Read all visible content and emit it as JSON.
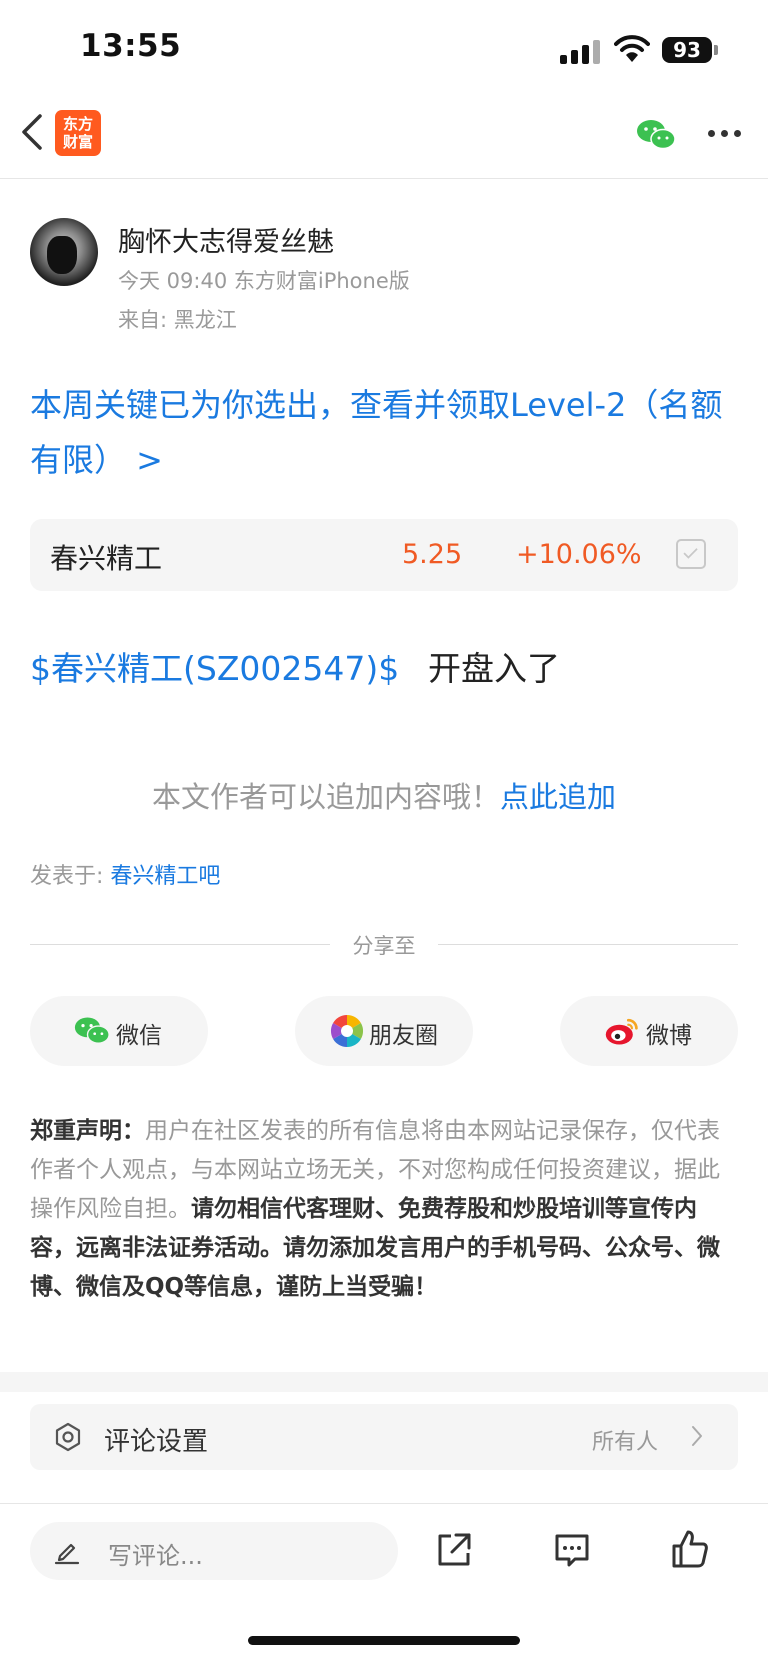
{
  "status_bar": {
    "time": "13:55",
    "battery": "93"
  },
  "nav": {
    "logo_line1": "东方",
    "logo_line2": "财富"
  },
  "author": {
    "name": "胸怀大志得爱丝魅",
    "meta": "今天 09:40 东方财富iPhone版",
    "from": "来自: 黑龙江"
  },
  "promo": {
    "text": "本周关键已为你选出，查看并领取Level-2（名额有限） >"
  },
  "stock": {
    "name": "春兴精工",
    "price": "5.25",
    "change": "+10.06%",
    "color": "#f05a24"
  },
  "post": {
    "tag": "$春兴精工(SZ002547)$",
    "text": "开盘入了"
  },
  "append": {
    "prompt": "本文作者可以追加内容哦！",
    "link": "点此追加"
  },
  "published": {
    "label": "发表于: ",
    "forum": "春兴精工吧"
  },
  "share": {
    "title": "分享至",
    "buttons": [
      {
        "label": "微信",
        "icon": "wechat-icon"
      },
      {
        "label": "朋友圈",
        "icon": "moments-icon"
      },
      {
        "label": "微博",
        "icon": "weibo-icon"
      }
    ]
  },
  "disclaimer": {
    "title": "郑重声明：",
    "normal": "用户在社区发表的所有信息将由本网站记录保存，仅代表作者个人观点，与本网站立场无关，不对您构成任何投资建议，据此操作风险自担。",
    "bold": "请勿相信代客理财、免费荐股和炒股培训等宣传内容，远离非法证券活动。请勿添加发言用户的手机号码、公众号、微博、微信及QQ等信息，谨防上当受骗！"
  },
  "comment_settings": {
    "label": "评论设置",
    "value": "所有人"
  },
  "bottom_bar": {
    "placeholder": "写评论..."
  },
  "colors": {
    "link": "#1a7ae0",
    "brand": "#ff5a1f",
    "rise": "#f05a24"
  }
}
